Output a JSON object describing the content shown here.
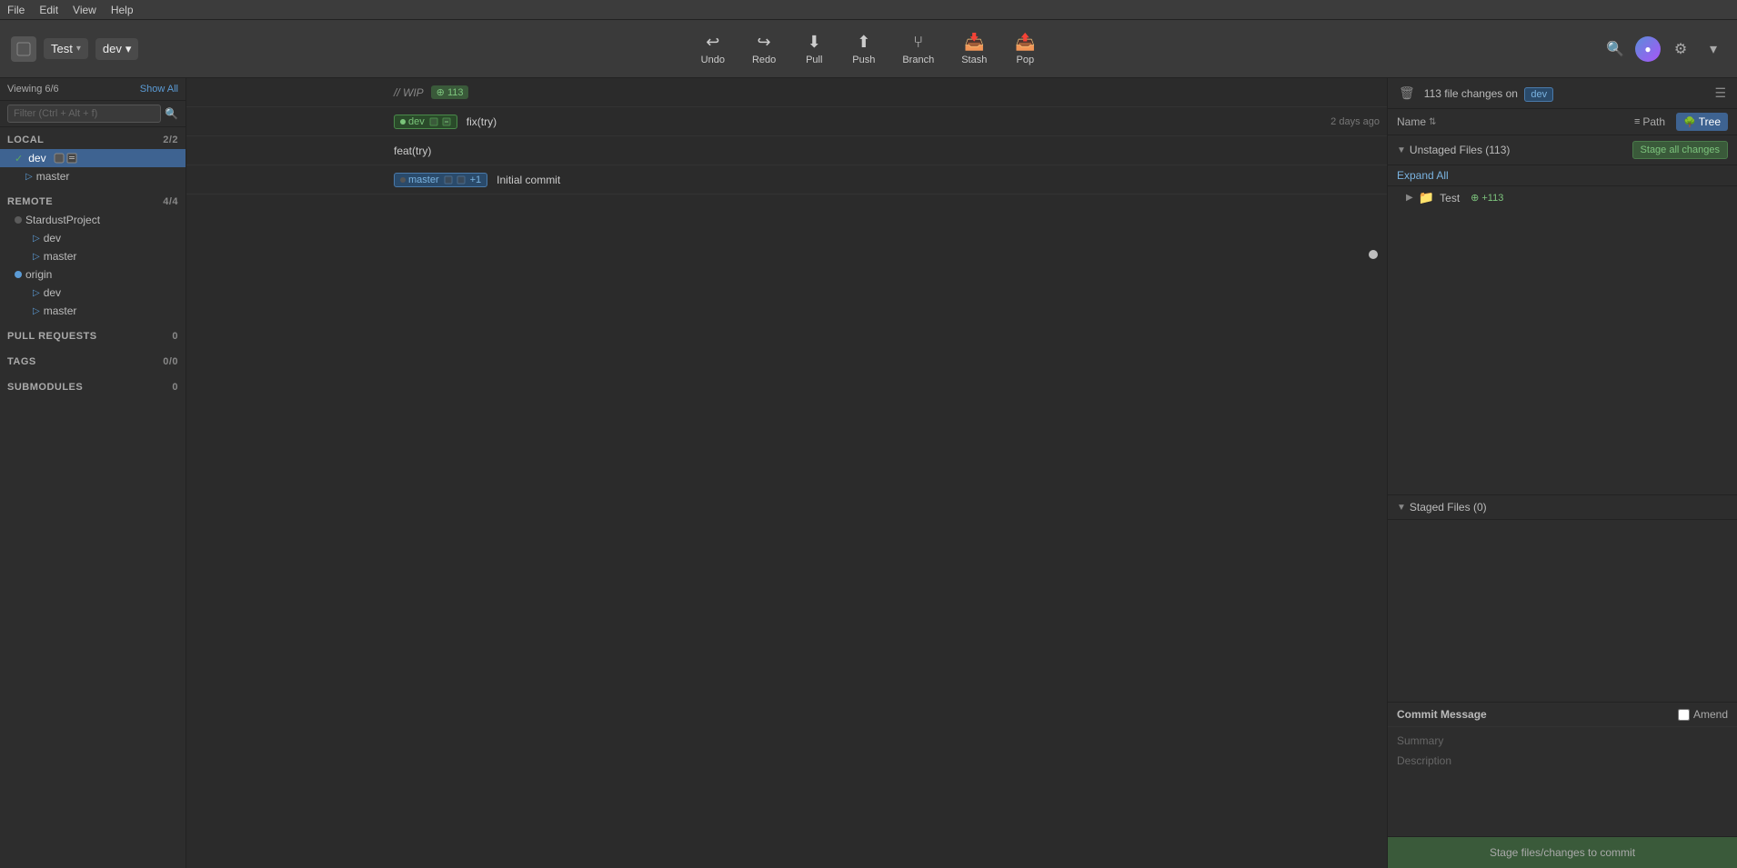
{
  "app": {
    "title": "Test"
  },
  "menubar": {
    "items": [
      "File",
      "Edit",
      "View",
      "Help"
    ]
  },
  "toolbar": {
    "repo_name": "Test",
    "branch_name": "dev",
    "undo_label": "Undo",
    "redo_label": "Redo",
    "pull_label": "Pull",
    "push_label": "Push",
    "branch_label": "Branch",
    "stash_label": "Stash",
    "pop_label": "Pop"
  },
  "sidebar": {
    "viewing_label": "Viewing 6/6",
    "show_all_label": "Show All",
    "filter_placeholder": "Filter (Ctrl + Alt + f)",
    "local_label": "LOCAL",
    "local_count": "2/2",
    "branches": {
      "dev": {
        "name": "dev",
        "active": true
      },
      "master_local": {
        "name": "master"
      }
    },
    "remote_label": "REMOTE",
    "remote_count": "4/4",
    "remote_groups": [
      {
        "name": "StardustProject",
        "branches": [
          "dev",
          "master"
        ]
      },
      {
        "name": "origin",
        "branches": [
          "dev",
          "master"
        ]
      }
    ],
    "pull_requests_label": "PULL REQUESTS",
    "pull_requests_count": "0",
    "tags_label": "TAGS",
    "tags_count": "0/0",
    "submodules_label": "SUBMODULES",
    "submodules_count": "0"
  },
  "graph": {
    "commits": [
      {
        "id": "wip",
        "label": "// WIP",
        "badge": "+113",
        "branch_labels": [
          "dev"
        ],
        "time": ""
      },
      {
        "id": "fix",
        "label": "fix(try)",
        "branch_labels": [],
        "time": "2 days ago"
      },
      {
        "id": "feat",
        "label": "feat(try)",
        "branch_labels": [],
        "time": ""
      },
      {
        "id": "initial",
        "label": "Initial commit",
        "branch_labels": [
          "master"
        ],
        "time": ""
      }
    ]
  },
  "right_panel": {
    "file_changes_label": "113 file changes on",
    "branch_name": "dev",
    "name_header": "Name",
    "path_button": "Path",
    "tree_button": "Tree",
    "unstaged_label": "Unstaged Files (113)",
    "stage_all_label": "Stage all changes",
    "expand_all_label": "Expand All",
    "test_folder": "Test",
    "test_folder_count": "+113",
    "staged_label": "Staged Files (0)",
    "commit_message_label": "Commit Message",
    "amend_label": "Amend",
    "summary_placeholder": "Summary",
    "description_placeholder": "Description",
    "stage_commit_label": "Stage files/changes to commit"
  }
}
